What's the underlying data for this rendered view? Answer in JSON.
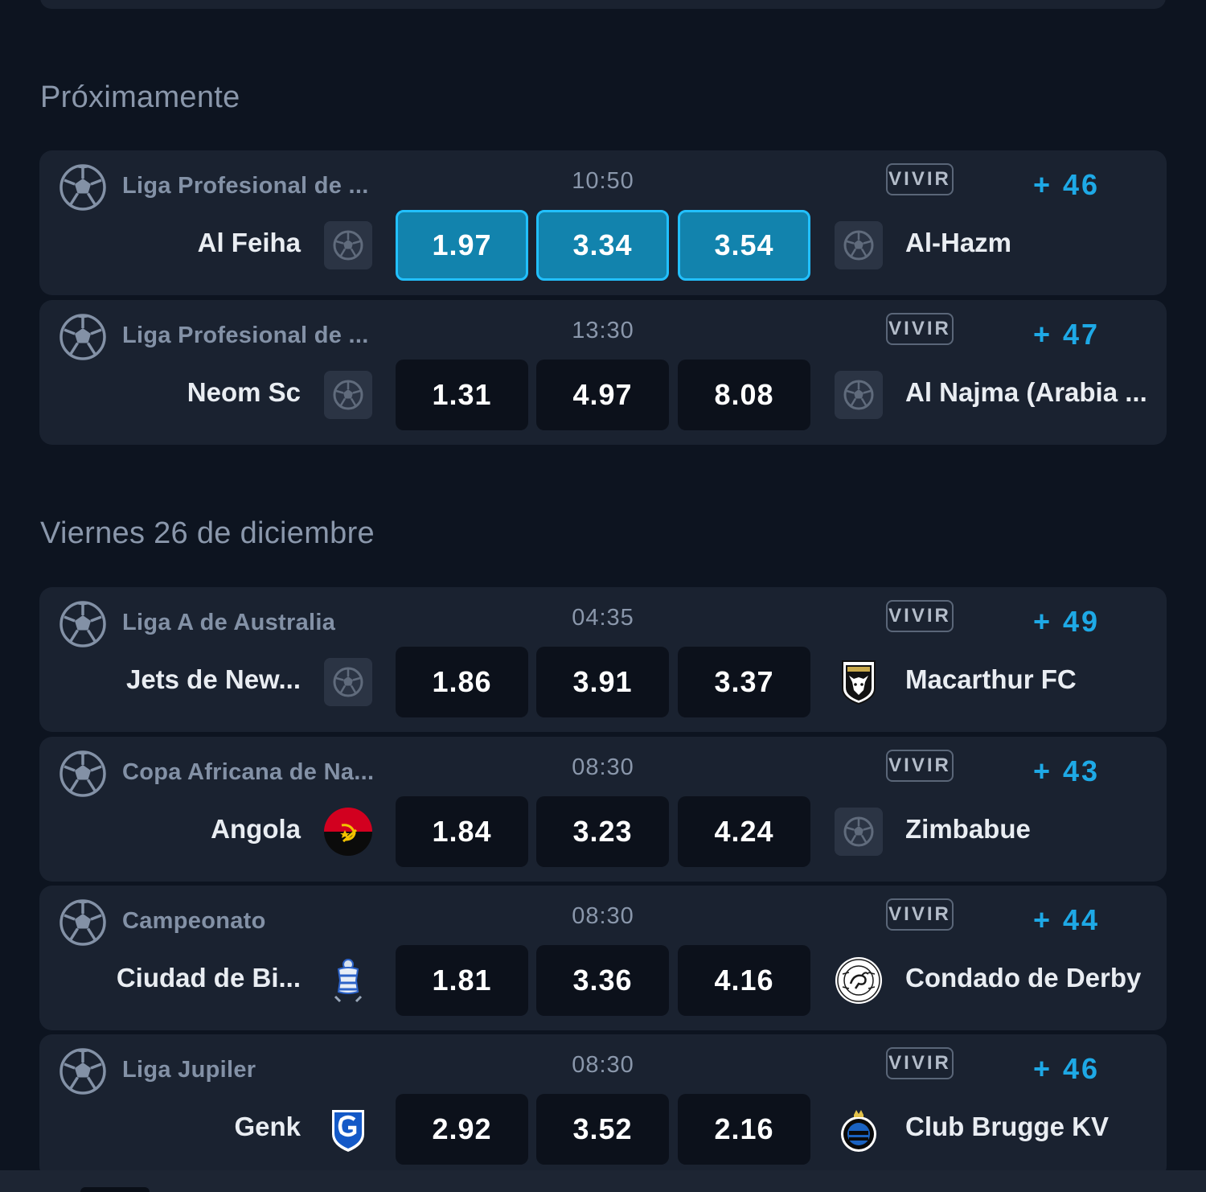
{
  "colors": {
    "page_background": "#0d1420",
    "card_background": "#1a2230",
    "odd_background": "#0c111b",
    "odd_selected_background": "#1283ad",
    "odd_selected_border": "#22c0ff",
    "accent_blue": "#1ea9e6",
    "muted_text": "#8391a6"
  },
  "sections": [
    {
      "title": "Próximamente",
      "matches": [
        {
          "league": "Liga Profesional de ...",
          "time": "10:50",
          "live_label": "VIVIR",
          "more_markets": "+ 46",
          "home": {
            "name": "Al Feiha",
            "logo": "soccer-ball-icon"
          },
          "away": {
            "name": "Al-Hazm",
            "logo": "soccer-ball-icon"
          },
          "odds": [
            "1.97",
            "3.34",
            "3.54"
          ],
          "selected": true
        },
        {
          "league": "Liga Profesional de ...",
          "time": "13:30",
          "live_label": "VIVIR",
          "more_markets": "+ 47",
          "home": {
            "name": "Neom Sc",
            "logo": "soccer-ball-icon"
          },
          "away": {
            "name": "Al Najma (Arabia ...",
            "logo": "soccer-ball-icon"
          },
          "odds": [
            "1.31",
            "4.97",
            "8.08"
          ],
          "selected": false
        }
      ]
    },
    {
      "title": "Viernes 26 de diciembre",
      "matches": [
        {
          "league": "Liga A de Australia",
          "time": "04:35",
          "live_label": "VIVIR",
          "more_markets": "+ 49",
          "home": {
            "name": "Jets de New...",
            "logo": "soccer-ball-icon"
          },
          "away": {
            "name": "Macarthur FC",
            "logo": "macarthur-crest-icon"
          },
          "odds": [
            "1.86",
            "3.91",
            "3.37"
          ],
          "selected": false
        },
        {
          "league": "Copa Africana de Na...",
          "time": "08:30",
          "live_label": "VIVIR",
          "more_markets": "+ 43",
          "home": {
            "name": "Angola",
            "logo": "angola-flag-icon"
          },
          "away": {
            "name": "Zimbabue",
            "logo": "soccer-ball-icon"
          },
          "odds": [
            "1.84",
            "3.23",
            "4.24"
          ],
          "selected": false
        },
        {
          "league": "Campeonato",
          "time": "08:30",
          "live_label": "VIVIR",
          "more_markets": "+ 44",
          "home": {
            "name": "Ciudad de Bi...",
            "logo": "birmingham-crest-icon"
          },
          "away": {
            "name": "Condado de Derby",
            "logo": "derby-crest-icon"
          },
          "odds": [
            "1.81",
            "3.36",
            "4.16"
          ],
          "selected": false
        },
        {
          "league": "Liga Jupiler",
          "time": "08:30",
          "live_label": "VIVIR",
          "more_markets": "+ 46",
          "home": {
            "name": "Genk",
            "logo": "genk-crest-icon"
          },
          "away": {
            "name": "Club Brugge KV",
            "logo": "brugge-crest-icon"
          },
          "odds": [
            "2.92",
            "3.52",
            "2.16"
          ],
          "selected": false
        }
      ]
    }
  ]
}
